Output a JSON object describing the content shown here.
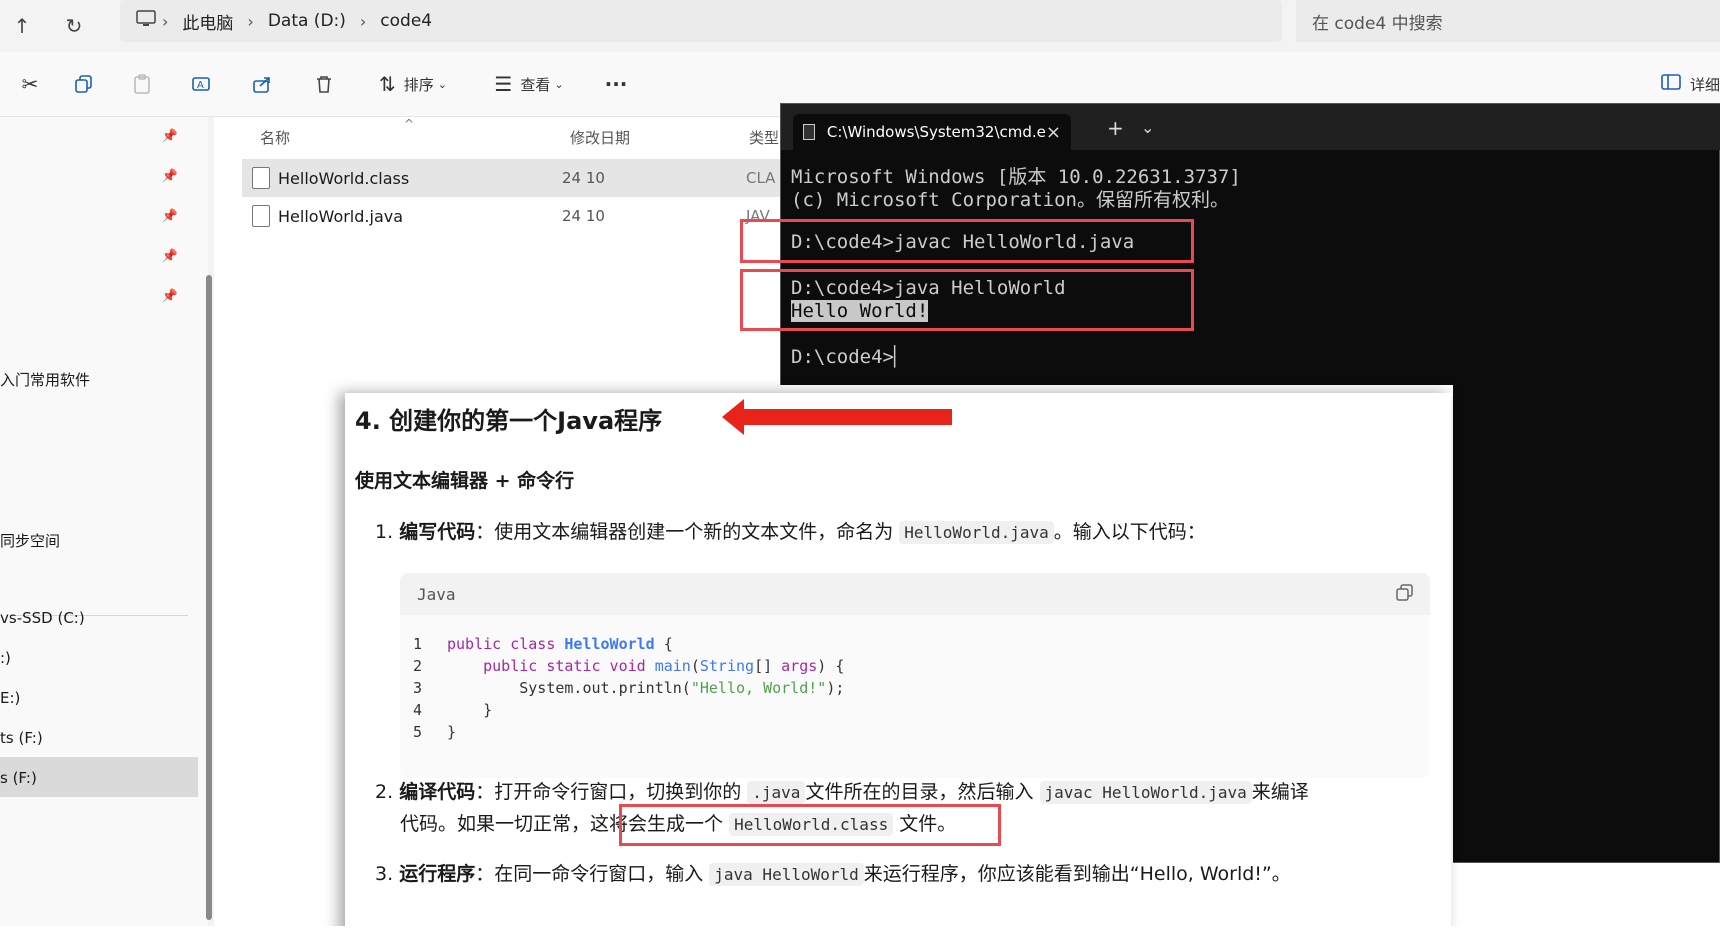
{
  "explorer": {
    "breadcrumb": [
      "此电脑",
      "Data (D:)",
      "code4"
    ],
    "search_placeholder": "在 code4 中搜索",
    "toolbar": {
      "sort_label": "排序",
      "view_label": "查看",
      "more_label": "···",
      "details_label": "详细"
    },
    "columns": {
      "name": "名称",
      "date": "修改日期",
      "type": "类型"
    },
    "files": [
      {
        "name": "HelloWorld.class",
        "date": "24 10",
        "type": "CLA"
      },
      {
        "name": "HelloWorld.java",
        "date": "24 10",
        "type": "JAV"
      }
    ],
    "nav": {
      "item_software": "入门常用软件",
      "item_sync": "同步空间",
      "drive_c": "vs-SSD (C:)",
      "drive_d": ":)",
      "drive_e": "E:)",
      "drive_f1": "ts (F:)",
      "drive_f2": "s (F:)"
    }
  },
  "cmd": {
    "tab_title": "C:\\Windows\\System32\\cmd.e",
    "lines": [
      "Microsoft Windows [版本 10.0.22631.3737]",
      "(c) Microsoft Corporation。保留所有权利。",
      "D:\\code4>javac HelloWorld.java",
      "D:\\code4>java HelloWorld",
      "Hello World!",
      "D:\\code4>"
    ]
  },
  "doc": {
    "heading": "4. 创建你的第一个Java程序",
    "subheading": "使用文本编辑器 + 命令行",
    "step1": {
      "num": "1.",
      "bold": "编写代码",
      "text": "：使用文本编辑器创建一个新的文本文件，命名为",
      "code": "HelloWorld.java",
      "text2": "。输入以下代码："
    },
    "code_lang": "Java",
    "code_lines": [
      {
        "n": "1",
        "text": "public class HelloWorld {"
      },
      {
        "n": "2",
        "text": "    public static void main(String[] args) {"
      },
      {
        "n": "3",
        "text": "        System.out.println(\"Hello, World!\");"
      },
      {
        "n": "4",
        "text": "    }"
      },
      {
        "n": "5",
        "text": "}"
      }
    ],
    "step2": {
      "num": "2.",
      "bold": "编译代码",
      "text": "：打开命令行窗口，切换到你的",
      "code1": ".java",
      "text2": "文件所在的目录，然后输入",
      "code2": "javac HelloWorld.java",
      "text3": "来编译",
      "line2a": "代码。如果一切正常，",
      "line2b": "这将会生成一个",
      "code3": "HelloWorld.class",
      "line2c": "文件。"
    },
    "step3": {
      "num": "3.",
      "bold": "运行程序",
      "text": "：在同一命令行窗口，输入",
      "code": "java HelloWorld",
      "text2": "来运行程序，你应该能看到输出“Hello, World!”。"
    }
  },
  "colors": {
    "red_box": "#e84a4f",
    "arrow_red": "#e8231a",
    "terminal_bg": "#0c0c0c"
  }
}
